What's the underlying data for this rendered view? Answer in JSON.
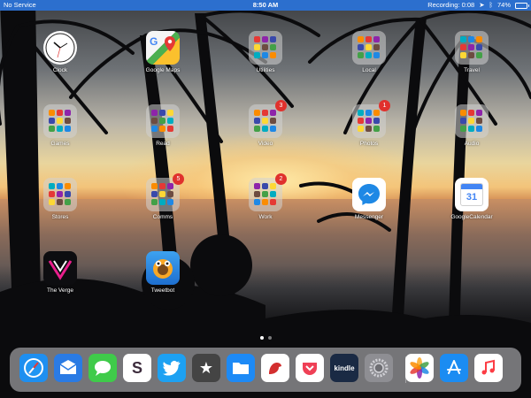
{
  "status_bar": {
    "carrier": "No Service",
    "time": "8:50 AM",
    "recording": "Recording: 0:08",
    "battery": "74%",
    "battery_level": 0.74
  },
  "apps": [
    {
      "label": "Clock",
      "type": "clock"
    },
    {
      "label": "Google Maps",
      "type": "maps"
    },
    {
      "label": "Utilities",
      "type": "folder",
      "badge": ""
    },
    {
      "label": "Local",
      "type": "folder",
      "badge": ""
    },
    {
      "label": "Travel",
      "type": "folder",
      "badge": ""
    },
    {
      "label": "Games",
      "type": "folder",
      "badge": ""
    },
    {
      "label": "Read",
      "type": "folder",
      "badge": ""
    },
    {
      "label": "Video",
      "type": "folder",
      "badge": "3"
    },
    {
      "label": "Photos",
      "type": "folder",
      "badge": "1"
    },
    {
      "label": "Audio",
      "type": "folder",
      "badge": ""
    },
    {
      "label": "Stores",
      "type": "folder",
      "badge": ""
    },
    {
      "label": "Comms",
      "type": "folder",
      "badge": "5"
    },
    {
      "label": "Work",
      "type": "folder",
      "badge": "2"
    },
    {
      "label": "Messenger",
      "type": "messenger"
    },
    {
      "label": "GoogleCalendar",
      "type": "calendar",
      "day": "31"
    },
    {
      "label": "The Verge",
      "type": "verge"
    },
    {
      "label": "Tweetbot",
      "type": "tweetbot"
    }
  ],
  "page_dots": {
    "count": 2,
    "active": 0
  },
  "dock": [
    {
      "name": "safari",
      "color": "#1e8ff0"
    },
    {
      "name": "airmail",
      "color": "#2a7be4"
    },
    {
      "name": "messages",
      "color": "#3fcb4a"
    },
    {
      "name": "slack",
      "color": "#ffffff"
    },
    {
      "name": "twitter",
      "color": "#1da1f2"
    },
    {
      "name": "reeder",
      "color": "#444444"
    },
    {
      "name": "files",
      "color": "#1d8af6"
    },
    {
      "name": "bear",
      "color": "#ffffff"
    },
    {
      "name": "pocket",
      "color": "#ffffff"
    },
    {
      "name": "kindle",
      "color": "#1a2a44",
      "text": "kindle"
    },
    {
      "name": "settings",
      "color": "#8e8e93"
    },
    {
      "name": "photos",
      "color": "#ffffff"
    },
    {
      "name": "app-store",
      "color": "#1b8cf2"
    },
    {
      "name": "music",
      "color": "#ffffff"
    }
  ],
  "colors": {
    "status_bar": "#2c6fce",
    "badge": "#e0312d",
    "folder_tint": "rgba(210,210,210,0.55)"
  }
}
